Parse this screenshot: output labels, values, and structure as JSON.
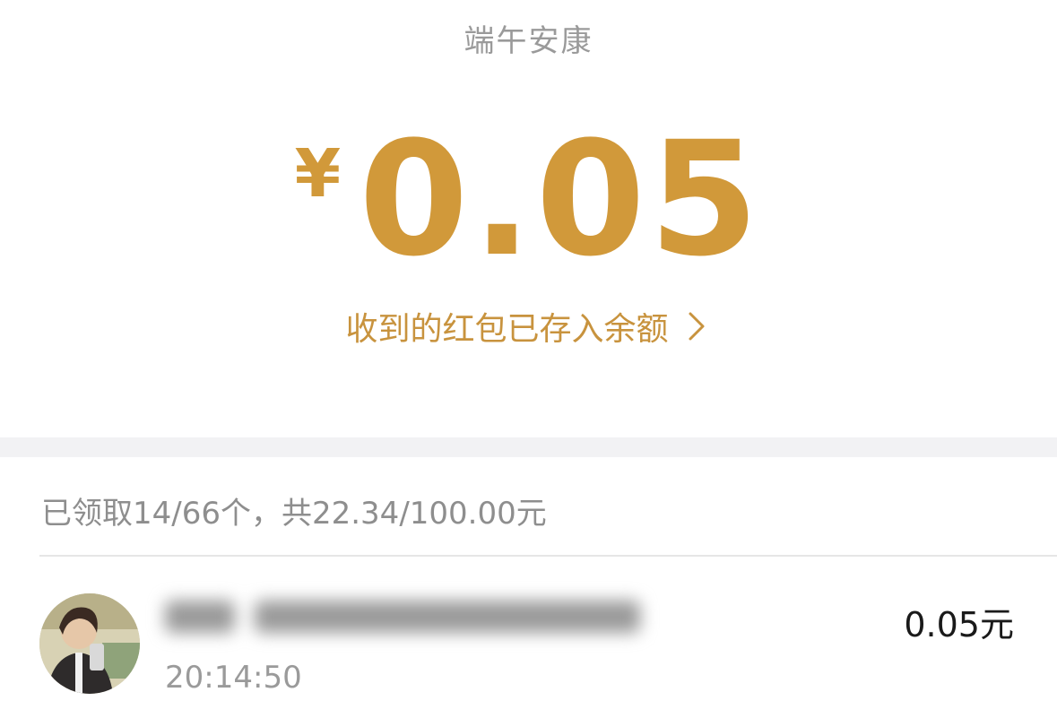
{
  "header": {
    "title": "端午安康"
  },
  "amount": {
    "currency_symbol": "¥",
    "value": "0.05",
    "color": "#d1993a"
  },
  "deposit": {
    "label": "收到的红包已存入余额",
    "icon": "chevron-right-icon"
  },
  "summary": {
    "text": "已领取14/66个，共22.34/100.00元"
  },
  "records": [
    {
      "avatar_icon": "user-avatar-photo",
      "time": "20:14:50",
      "amount": "0.05元"
    }
  ]
}
